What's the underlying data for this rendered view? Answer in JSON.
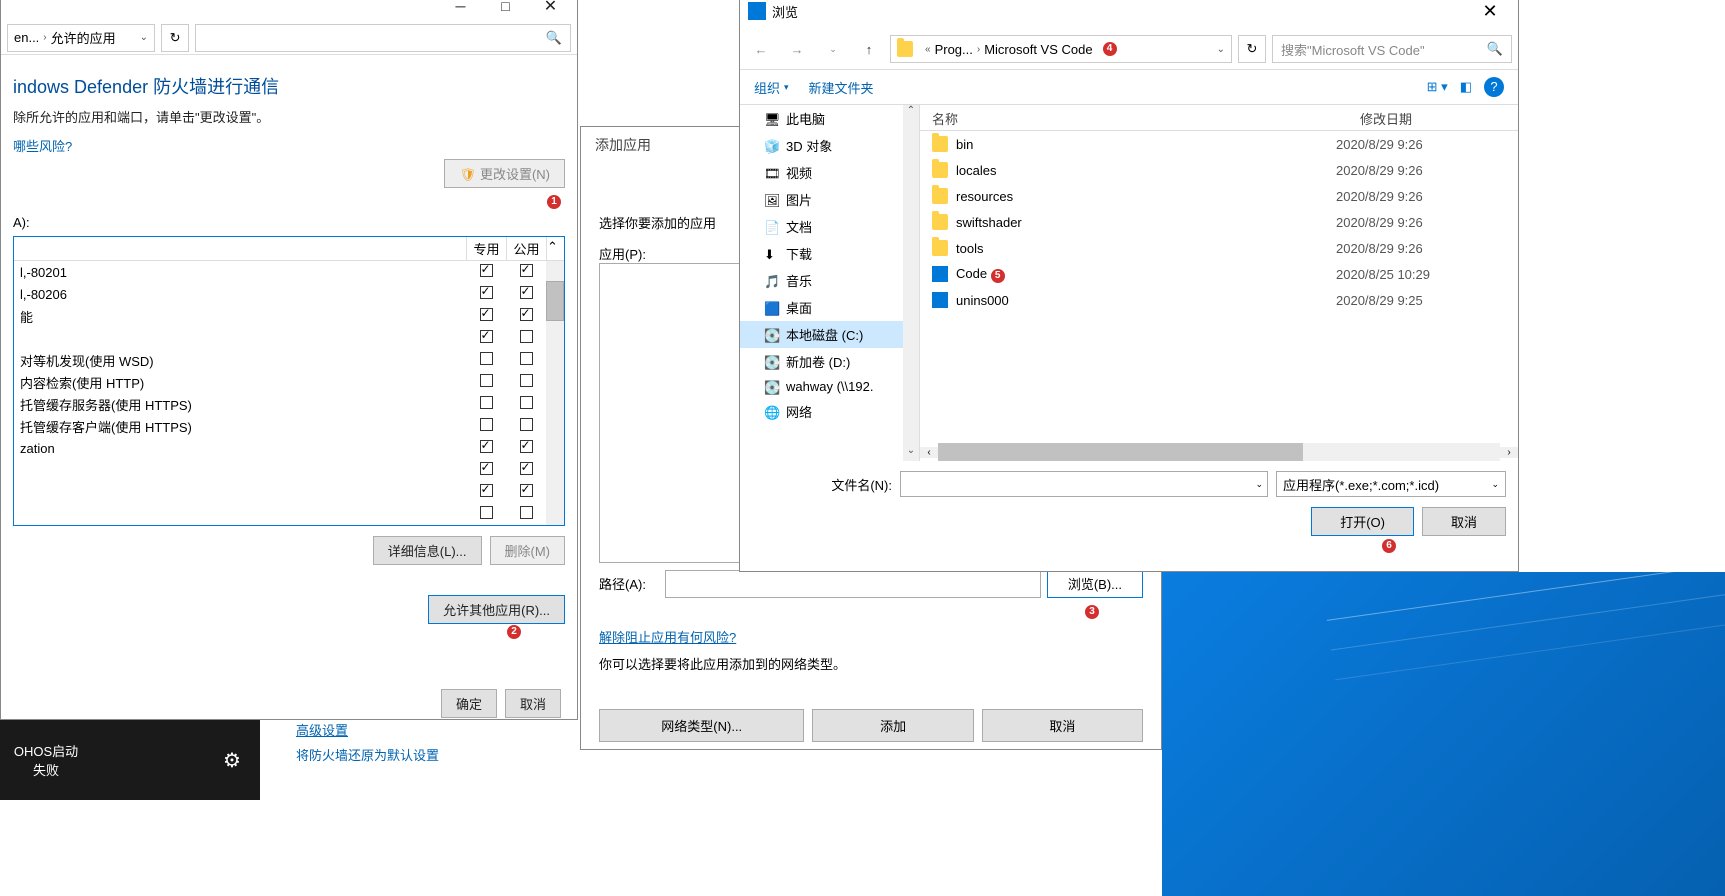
{
  "firewall": {
    "breadcrumb_truncated": "en...",
    "breadcrumb_last": "允许的应用",
    "heading": "indows Defender 防火墙进行通信",
    "subtext": "除所允许的应用和端口，请单击\"更改设置\"。",
    "risks_link": "哪些风险?",
    "change_settings_btn": "更改设置(N)",
    "allowed_label": "A):",
    "th_private": "专用",
    "th_public": "公用",
    "rows": [
      {
        "name": "l,-80201",
        "pv": true,
        "pu": true
      },
      {
        "name": "l,-80206",
        "pv": true,
        "pu": true
      },
      {
        "name": "能",
        "pv": true,
        "pu": true
      },
      {
        "name": "",
        "pv": true,
        "pu": false
      },
      {
        "name": "对等机发现(使用 WSD)",
        "pv": false,
        "pu": false
      },
      {
        "name": "内容检索(使用 HTTP)",
        "pv": false,
        "pu": false
      },
      {
        "name": "托管缓存服务器(使用 HTTPS)",
        "pv": false,
        "pu": false
      },
      {
        "name": "托管缓存客户端(使用 HTTPS)",
        "pv": false,
        "pu": false
      },
      {
        "name": "zation",
        "pv": true,
        "pu": true
      },
      {
        "name": "",
        "pv": true,
        "pu": true
      },
      {
        "name": "",
        "pv": true,
        "pu": true
      },
      {
        "name": "",
        "pv": false,
        "pu": false
      }
    ],
    "details_btn": "详细信息(L)...",
    "remove_btn": "删除(M)",
    "allow_other_btn": "允许其他应用(R)...",
    "ok_btn": "确定",
    "cancel_btn": "取消"
  },
  "addapp": {
    "title": "添加应用",
    "select_text": "选择你要添加的应用",
    "app_label": "应用(P):",
    "path_label": "路径(A):",
    "browse_btn": "浏览(B)...",
    "unblock_link": "解除阻止应用有何风险?",
    "nettypes_text": "你可以选择要将此应用添加到的网络类型。",
    "nettypes_btn": "网络类型(N)...",
    "add_btn": "添加",
    "cancel_btn": "取消"
  },
  "browse": {
    "title": "浏览",
    "crumb1": "Prog...",
    "crumb2": "Microsoft VS Code",
    "search_placeholder": "搜索\"Microsoft VS Code\"",
    "organize": "组织",
    "newfolder": "新建文件夹",
    "col_name": "名称",
    "col_date": "修改日期",
    "tree": [
      {
        "label": "此电脑",
        "icon": "pc"
      },
      {
        "label": "3D 对象",
        "icon": "3d"
      },
      {
        "label": "视频",
        "icon": "video"
      },
      {
        "label": "图片",
        "icon": "pic"
      },
      {
        "label": "文档",
        "icon": "doc"
      },
      {
        "label": "下载",
        "icon": "dl"
      },
      {
        "label": "音乐",
        "icon": "music"
      },
      {
        "label": "桌面",
        "icon": "desktop"
      },
      {
        "label": "本地磁盘 (C:)",
        "icon": "disk",
        "selected": true
      },
      {
        "label": "新加卷 (D:)",
        "icon": "disk"
      },
      {
        "label": "wahway (\\\\192.",
        "icon": "net"
      },
      {
        "label": "网络",
        "icon": "net2"
      }
    ],
    "files": [
      {
        "name": "bin",
        "date": "2020/8/29 9:26",
        "type": "folder"
      },
      {
        "name": "locales",
        "date": "2020/8/29 9:26",
        "type": "folder"
      },
      {
        "name": "resources",
        "date": "2020/8/29 9:26",
        "type": "folder"
      },
      {
        "name": "swiftshader",
        "date": "2020/8/29 9:26",
        "type": "folder"
      },
      {
        "name": "tools",
        "date": "2020/8/29 9:26",
        "type": "folder"
      },
      {
        "name": "Code",
        "date": "2020/8/25 10:29",
        "type": "vscode"
      },
      {
        "name": "unins000",
        "date": "2020/8/29 9:25",
        "type": "vscode"
      }
    ],
    "filename_label": "文件名(N):",
    "filetype": "应用程序(*.exe;*.com;*.icd)",
    "open_btn": "打开(O)",
    "cancel_btn": "取消"
  },
  "taskbar": {
    "item": "OHOS启动失败"
  },
  "bottomlinks": {
    "l1": "高级设置",
    "l2": "将防火墙还原为默认设置"
  },
  "badges": {
    "b1": "1",
    "b2": "2",
    "b3": "3",
    "b4": "4",
    "b5": "5",
    "b6": "6"
  }
}
